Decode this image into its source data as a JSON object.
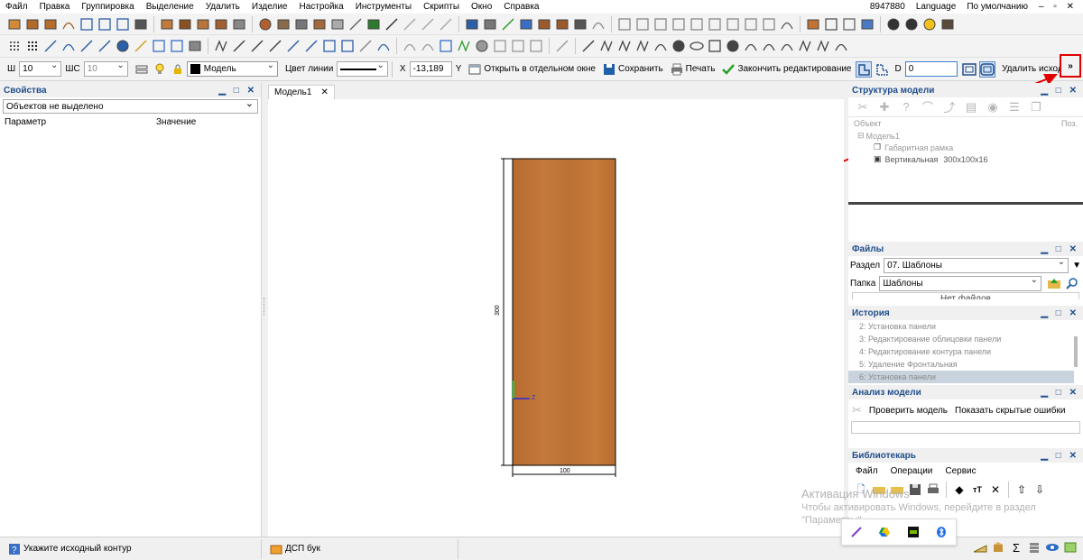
{
  "menu": {
    "items": [
      "Файл",
      "Правка",
      "Группировка",
      "Выделение",
      "Удалить",
      "Изделие",
      "Настройка",
      "Инструменты",
      "Скрипты",
      "Окно",
      "Справка"
    ],
    "account": "8947880",
    "language": "Language",
    "profile": "По умолчанию"
  },
  "props_row": {
    "w_label": "Ш",
    "w_value": "10",
    "wc_label": "ШС",
    "wc_value": "10",
    "layer": "Модель",
    "line_color_label": "Цвет линии",
    "x_label": "X",
    "x_value": "-13,189",
    "y_label": "Y",
    "open_window": "Открыть в отдельном окне",
    "save": "Сохранить",
    "print": "Печать",
    "finish_edit": "Закончить редактирование",
    "d_label": "D",
    "d_value": "0",
    "delete_source": "Удалить исходный",
    "more": "»"
  },
  "properties_panel": {
    "title": "Свойства",
    "selection": "Объектов не выделено",
    "col_param": "Параметр",
    "col_value": "Значение"
  },
  "document": {
    "tab": "Модель1",
    "close": "✕"
  },
  "drawing": {
    "height_dim": "300",
    "width_dim": "100",
    "axis_label": "Z",
    "panel_color": "#c07335"
  },
  "structure": {
    "title": "Структура модели",
    "col_object": "Объект",
    "col_pos": "Поз.",
    "root": "Модель1",
    "child1": "Габаритная рамка",
    "child2_name": "Вертикальная",
    "child2_size": "300x100x16"
  },
  "files": {
    "title": "Файлы",
    "section_label": "Раздел",
    "section_value": "07. Шаблоны",
    "folder_label": "Папка",
    "folder_value": "Шаблоны",
    "empty": "Нет файлов"
  },
  "history": {
    "title": "История",
    "items": [
      "2:   Установка панели",
      "3:   Редактирование облицовки панели",
      "4:   Редактирование контура панели",
      "5:   Удаление Фронтальная",
      "6:   Установка панели"
    ]
  },
  "analysis": {
    "title": "Анализ модели",
    "check": "Проверить модель",
    "show_errors": "Показать скрытые ошибки"
  },
  "librarian": {
    "title": "Библиотекарь",
    "menu": [
      "Файл",
      "Операции",
      "Сервис"
    ]
  },
  "status": {
    "hint": "Укажите исходный контур",
    "material": "ДСП бук"
  },
  "watermark": {
    "line1": "Активация Windows",
    "line2": "Чтобы активировать Windows, перейдите в раздел",
    "line3": "\"Параметры\"."
  },
  "panel_controls": "▁ □ ✕"
}
